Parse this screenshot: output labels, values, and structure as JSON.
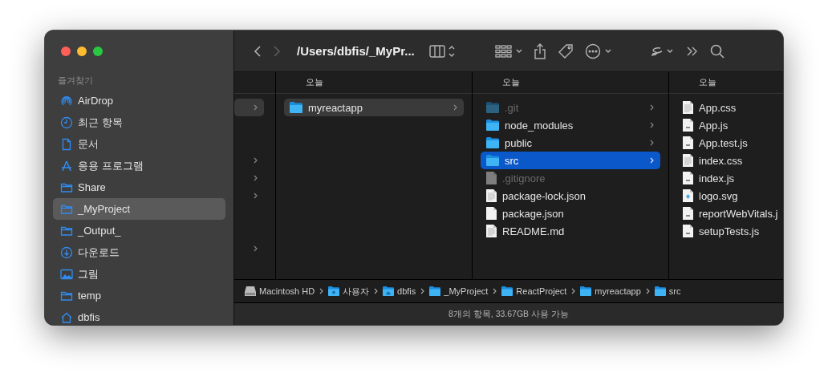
{
  "sidebar": {
    "heading": "즐겨찾기",
    "items": [
      {
        "label": "AirDrop",
        "selected": false
      },
      {
        "label": "최근 항목",
        "selected": false
      },
      {
        "label": "문서",
        "selected": false
      },
      {
        "label": "응용 프로그램",
        "selected": false
      },
      {
        "label": "Share",
        "selected": false
      },
      {
        "label": "_MyProject",
        "selected": true
      },
      {
        "label": "_Output_",
        "selected": false
      },
      {
        "label": "다운로드",
        "selected": false
      },
      {
        "label": "그림",
        "selected": false
      },
      {
        "label": "temp",
        "selected": false
      },
      {
        "label": "dbfis",
        "selected": false
      }
    ]
  },
  "toolbar": {
    "title": "/Users/dbfis/_MyPr...",
    "back_enabled": true,
    "forward_enabled": false
  },
  "columns": [
    {
      "focused": false,
      "rows": [
        {
          "selected": true,
          "has_children": true
        },
        {
          "selected": false,
          "has_children": false
        },
        {
          "selected": false,
          "has_children": false
        },
        {
          "selected": false,
          "has_children": true
        },
        {
          "selected": false,
          "has_children": true
        },
        {
          "selected": false,
          "has_children": true
        },
        {
          "selected": false,
          "has_children": false
        },
        {
          "selected": false,
          "has_children": false
        },
        {
          "selected": false,
          "has_children": true
        }
      ]
    },
    {
      "header": "오늘",
      "focused": false,
      "rows": [
        {
          "name": "myreactapp",
          "kind": "folder",
          "hidden": false,
          "selected": true,
          "has_children": true
        }
      ]
    },
    {
      "header": "오늘",
      "focused": true,
      "rows": [
        {
          "name": ".git",
          "kind": "folder",
          "hidden": true,
          "selected": false,
          "has_children": true
        },
        {
          "name": "node_modules",
          "kind": "folder",
          "hidden": false,
          "selected": false,
          "has_children": true
        },
        {
          "name": "public",
          "kind": "folder",
          "hidden": false,
          "selected": false,
          "has_children": true
        },
        {
          "name": "src",
          "kind": "folder",
          "hidden": false,
          "selected": true,
          "has_children": true
        },
        {
          "name": ".gitignore",
          "kind": "blank",
          "hidden": true,
          "selected": false,
          "has_children": false
        },
        {
          "name": "package-lock.json",
          "kind": "text",
          "hidden": false,
          "selected": false,
          "has_children": false
        },
        {
          "name": "package.json",
          "kind": "blank",
          "hidden": false,
          "selected": false,
          "has_children": false
        },
        {
          "name": "README.md",
          "kind": "text",
          "hidden": false,
          "selected": false,
          "has_children": false
        }
      ]
    },
    {
      "header": "오늘",
      "rows": [
        {
          "name": "App.css",
          "kind": "text",
          "hidden": false,
          "selected": false,
          "has_children": false
        },
        {
          "name": "App.js",
          "kind": "script",
          "hidden": false,
          "selected": false,
          "has_children": false
        },
        {
          "name": "App.test.js",
          "kind": "script",
          "hidden": false,
          "selected": false,
          "has_children": false
        },
        {
          "name": "index.css",
          "kind": "text",
          "hidden": false,
          "selected": false,
          "has_children": false
        },
        {
          "name": "index.js",
          "kind": "script",
          "hidden": false,
          "selected": false,
          "has_children": false
        },
        {
          "name": "logo.svg",
          "kind": "image",
          "hidden": false,
          "selected": false,
          "has_children": false
        },
        {
          "name": "reportWebVitals.j",
          "kind": "script",
          "hidden": false,
          "selected": false,
          "has_children": false
        },
        {
          "name": "setupTests.js",
          "kind": "script",
          "hidden": false,
          "selected": false,
          "has_children": false
        }
      ]
    }
  ],
  "path_bar": [
    {
      "label": "Macintosh HD",
      "kind": "disk"
    },
    {
      "label": "사용자",
      "kind": "users-folder"
    },
    {
      "label": "dbfis",
      "kind": "home-folder"
    },
    {
      "label": "_MyProject",
      "kind": "folder"
    },
    {
      "label": "ReactProject",
      "kind": "folder"
    },
    {
      "label": "myreactapp",
      "kind": "folder"
    },
    {
      "label": "src",
      "kind": "folder"
    }
  ],
  "status_bar": "8개의 항목, 33.67GB 사용 가능"
}
